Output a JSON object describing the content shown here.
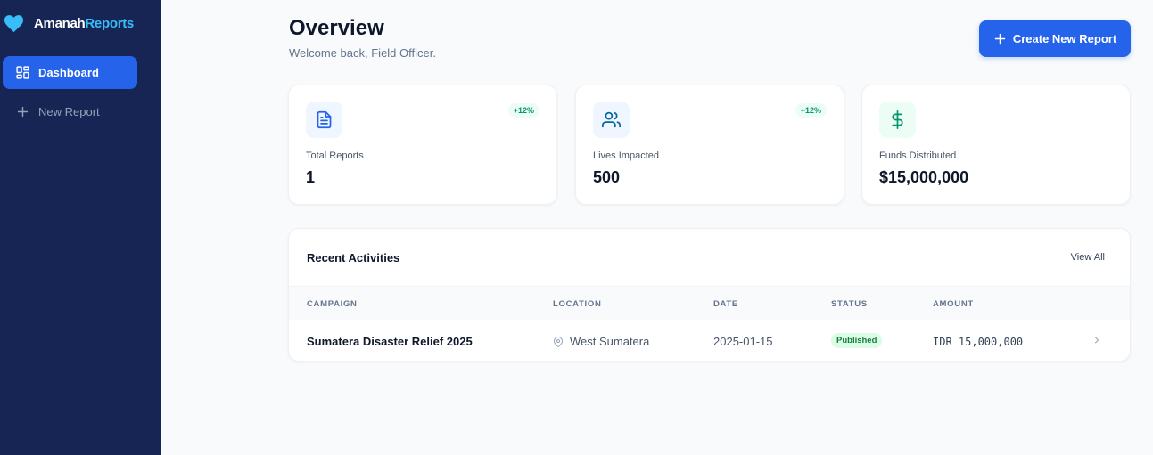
{
  "brand": {
    "name_a": "Amanah",
    "name_b": "Reports"
  },
  "sidebar": {
    "items": [
      {
        "label": "Dashboard",
        "icon": "dashboard-icon",
        "active": true
      },
      {
        "label": "New Report",
        "icon": "plus-icon",
        "active": false
      }
    ]
  },
  "header": {
    "title": "Overview",
    "subtitle": "Welcome back, Field Officer.",
    "create_button": "Create New Report"
  },
  "stats": [
    {
      "label": "Total Reports",
      "value": "1",
      "badge": "+12%",
      "icon": "document-icon"
    },
    {
      "label": "Lives Impacted",
      "value": "500",
      "badge": "+12%",
      "icon": "users-icon"
    },
    {
      "label": "Funds Distributed",
      "value": "$15,000,000",
      "icon": "dollar-icon"
    }
  ],
  "activities": {
    "title": "Recent Activities",
    "view_all": "View All",
    "columns": [
      "CAMPAIGN",
      "LOCATION",
      "DATE",
      "STATUS",
      "AMOUNT"
    ],
    "rows": [
      {
        "campaign": "Sumatera Disaster Relief 2025",
        "location": "West Sumatera",
        "date": "2025-01-15",
        "status": "Published",
        "amount": "IDR 15,000,000"
      }
    ]
  },
  "colors": {
    "sidebar": "#172554",
    "accent": "#2563eb",
    "brand_accent": "#38bdf8",
    "success": "#059669"
  }
}
